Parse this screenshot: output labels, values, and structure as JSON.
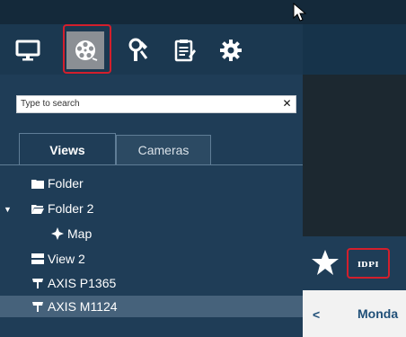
{
  "colors": {
    "accent_red": "#d31f2c",
    "panel": "#1f3d57",
    "toolbar": "#1b3850",
    "selected_row": "#46627b"
  },
  "toolbar": {
    "buttons": [
      {
        "name": "live-view",
        "icon": "monitor-icon",
        "active": false
      },
      {
        "name": "playback",
        "icon": "film-reel-icon",
        "active": true
      },
      {
        "name": "tools",
        "icon": "tools-icon",
        "active": false
      },
      {
        "name": "logs",
        "icon": "clipboard-icon",
        "active": false
      },
      {
        "name": "configuration",
        "icon": "gear-icon",
        "active": false
      }
    ]
  },
  "search": {
    "placeholder": "Type to search",
    "clear_glyph": "✕"
  },
  "tabs": [
    {
      "label": "Views",
      "active": true
    },
    {
      "label": "Cameras",
      "active": false
    }
  ],
  "tree": {
    "items": [
      {
        "label": "Folder",
        "icon": "folder-icon"
      },
      {
        "label": "Folder 2",
        "icon": "folder-open-icon",
        "expanded": true
      },
      {
        "label": "Map",
        "icon": "map-icon"
      },
      {
        "label": "View 2",
        "icon": "view-icon"
      },
      {
        "label": "AXIS P1365",
        "icon": "camera-icon"
      },
      {
        "label": "AXIS M1124",
        "icon": "camera-icon",
        "selected": true
      }
    ]
  },
  "side_panel": {
    "star_icon": "star-icon",
    "timeline_button_label": "ɪᴅᴘɪ"
  },
  "date_nav": {
    "prev_glyph": "<",
    "day_label": "Monda"
  }
}
